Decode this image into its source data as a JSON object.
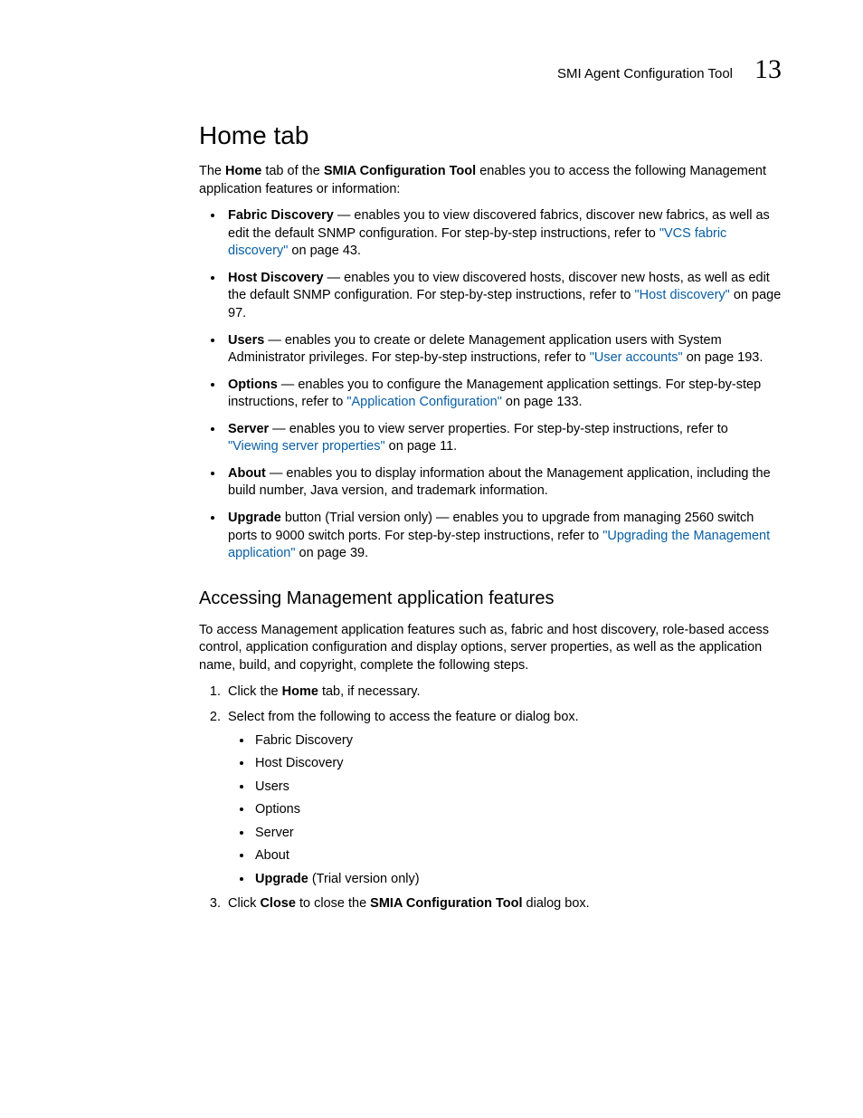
{
  "header": {
    "title": "SMI Agent Configuration Tool",
    "chapter": "13"
  },
  "section": {
    "title": "Home tab",
    "intro_pre": "The ",
    "intro_bold1": "Home",
    "intro_mid1": " tab of the ",
    "intro_bold2": "SMIA Configuration Tool",
    "intro_post": " enables you to access the following Management application features or information:"
  },
  "bullets": [
    {
      "term": "Fabric Discovery",
      "text_before_link": " — enables you to view discovered fabrics, discover new fabrics, as well as edit the default SNMP configuration. For step-by-step instructions, refer to ",
      "link": "\"VCS fabric discovery\"",
      "text_after_link": " on page 43."
    },
    {
      "term": "Host Discovery",
      "text_before_link": " — enables you to view discovered hosts, discover new hosts, as well as edit the default SNMP configuration. For step-by-step instructions, refer to ",
      "link": "\"Host discovery\"",
      "text_after_link": " on page 97."
    },
    {
      "term": "Users",
      "text_before_link": " — enables you to create or delete Management application users with System Administrator privileges. For step-by-step instructions, refer to ",
      "link": "\"User accounts\"",
      "text_after_link": " on page 193."
    },
    {
      "term": "Options",
      "text_before_link": " — enables you to configure the Management application settings. For step-by-step instructions, refer to ",
      "link": "\"Application Configuration\"",
      "text_after_link": " on page 133."
    },
    {
      "term": "Server",
      "text_before_link": " — enables you to view server properties. For step-by-step instructions, refer to ",
      "link": "\"Viewing server properties\"",
      "text_after_link": " on page 11."
    },
    {
      "term": "About",
      "text_before_link": " — enables you to display information about the Management application, including the build number, Java version, and trademark information.",
      "link": "",
      "text_after_link": ""
    },
    {
      "term": "Upgrade",
      "text_before_link": " button (Trial version only) — enables you to upgrade from managing 2560 switch ports to 9000 switch ports. For step-by-step instructions, refer to ",
      "link": "\"Upgrading the Management application\"",
      "text_after_link": " on page 39."
    }
  ],
  "subsection": {
    "title": "Accessing Management application features",
    "intro": "To access Management application features such as, fabric and host discovery, role-based access control, application configuration and display options, server properties, as well as the application name, build, and copyright, complete the following steps."
  },
  "steps": {
    "s1_pre": "Click the ",
    "s1_bold": "Home",
    "s1_post": " tab, if necessary.",
    "s2": "Select from the following to access the feature or dialog box.",
    "s2_items": [
      "Fabric Discovery",
      "Host Discovery",
      "Users",
      "Options",
      "Server",
      "About"
    ],
    "s2_last_bold": "Upgrade",
    "s2_last_post": " (Trial version only)",
    "s3_pre": "Click ",
    "s3_bold1": "Close",
    "s3_mid": " to close the ",
    "s3_bold2": "SMIA Configuration Tool",
    "s3_post": " dialog box."
  }
}
